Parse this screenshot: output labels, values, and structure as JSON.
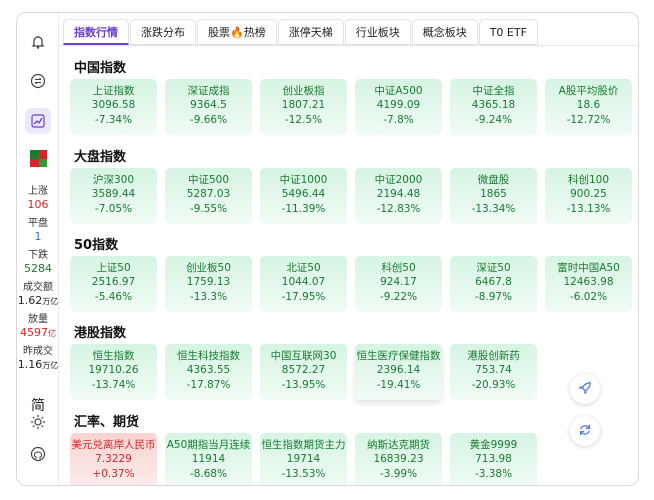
{
  "tabs": [
    "指数行情",
    "涨跌分布",
    "股票🔥热榜",
    "涨停天梯",
    "行业板块",
    "概念板块",
    "T0 ETF"
  ],
  "sidebar": {
    "stats": [
      {
        "label": "上涨",
        "value": "106",
        "color": "#d8252a"
      },
      {
        "label": "平盘",
        "value": "1",
        "color": "#2a6fd8"
      },
      {
        "label": "下跌",
        "value": "5284",
        "color": "#167c2e"
      },
      {
        "label": "成交额",
        "value": "1.62",
        "unit": "万亿",
        "color": "#222"
      },
      {
        "label": "放量",
        "value": "4597",
        "unit": "亿",
        "color": "#d8252a"
      },
      {
        "label": "昨成交",
        "value": "1.16",
        "unit": "万亿",
        "color": "#222"
      }
    ],
    "lang": "简",
    "icons": [
      "bell-icon",
      "swap-icon",
      "chart-line-icon",
      "heatmap-icon",
      "sun-icon",
      "github-icon"
    ]
  },
  "sections": [
    {
      "title": "中国指数",
      "cards": [
        {
          "name": "上证指数",
          "price": "3096.58",
          "pct": "-7.34%"
        },
        {
          "name": "深证成指",
          "price": "9364.5",
          "pct": "-9.66%"
        },
        {
          "name": "创业板指",
          "price": "1807.21",
          "pct": "-12.5%"
        },
        {
          "name": "中证A500",
          "price": "4199.09",
          "pct": "-7.8%"
        },
        {
          "name": "中证全指",
          "price": "4365.18",
          "pct": "-9.24%"
        },
        {
          "name": "A股平均股价",
          "price": "18.6",
          "pct": "-12.72%"
        }
      ]
    },
    {
      "title": "大盘指数",
      "cards": [
        {
          "name": "沪深300",
          "price": "3589.44",
          "pct": "-7.05%"
        },
        {
          "name": "中证500",
          "price": "5287.03",
          "pct": "-9.55%"
        },
        {
          "name": "中证1000",
          "price": "5496.44",
          "pct": "-11.39%"
        },
        {
          "name": "中证2000",
          "price": "2194.48",
          "pct": "-12.83%"
        },
        {
          "name": "微盘股",
          "price": "1865",
          "pct": "-13.34%"
        },
        {
          "name": "科创100",
          "price": "900.25",
          "pct": "-13.13%"
        }
      ]
    },
    {
      "title": "50指数",
      "cards": [
        {
          "name": "上证50",
          "price": "2516.97",
          "pct": "-5.46%"
        },
        {
          "name": "创业板50",
          "price": "1759.13",
          "pct": "-13.3%"
        },
        {
          "name": "北证50",
          "price": "1044.07",
          "pct": "-17.95%"
        },
        {
          "name": "科创50",
          "price": "924.17",
          "pct": "-9.22%"
        },
        {
          "name": "深证50",
          "price": "6467.8",
          "pct": "-8.97%"
        },
        {
          "name": "富时中国A50",
          "price": "12463.98",
          "pct": "-6.02%"
        }
      ]
    },
    {
      "title": "港股指数",
      "cards": [
        {
          "name": "恒生指数",
          "price": "19710.26",
          "pct": "-13.74%"
        },
        {
          "name": "恒生科技指数",
          "price": "4363.55",
          "pct": "-17.87%"
        },
        {
          "name": "中国互联网30",
          "price": "8572.27",
          "pct": "-13.95%"
        },
        {
          "name": "恒生医疗保健指数",
          "price": "2396.14",
          "pct": "-19.41%",
          "lift": true
        },
        {
          "name": "港股创新药",
          "price": "753.74",
          "pct": "-20.93%"
        }
      ]
    },
    {
      "title": "汇率、期货",
      "cards": [
        {
          "name": "美元兑离岸人民币",
          "price": "7.3229",
          "pct": "+0.37%",
          "up": true
        },
        {
          "name": "A50期指当月连续",
          "price": "11914",
          "pct": "-8.68%"
        },
        {
          "name": "恒生指数期货主力",
          "price": "19714",
          "pct": "-13.53%"
        },
        {
          "name": "纳斯达克期货",
          "price": "16839.23",
          "pct": "-3.99%"
        },
        {
          "name": "黄金9999",
          "price": "713.98",
          "pct": "-3.38%"
        }
      ]
    }
  ],
  "float_buttons": [
    "rocket-icon",
    "refresh-icon"
  ]
}
